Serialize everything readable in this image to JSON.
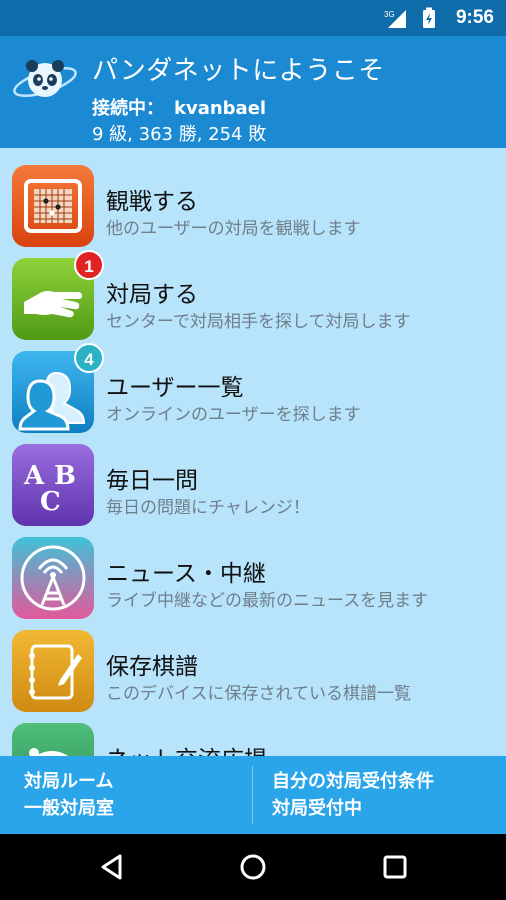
{
  "status_bar": {
    "network": "3G",
    "time": "9:56"
  },
  "header": {
    "title": "パンダネットにようこそ",
    "connection_label": "接続中：",
    "username": "kvanbael",
    "record": "9 級, 363 勝, 254 敗"
  },
  "menu": {
    "items": [
      {
        "title": "観戦する",
        "subtitle": "他のユーザーの対局を観戦します",
        "icon": "go-board-icon",
        "color": "#e8541c"
      },
      {
        "title": "対局する",
        "subtitle": "センターで対局相手を探して対局します",
        "icon": "hand-icon",
        "color": "#6fb624",
        "badge": "1",
        "badge_color": "#e02424"
      },
      {
        "title": "ユーザー一覧",
        "subtitle": "オンラインのユーザーを探します",
        "icon": "users-icon",
        "color": "#1f9ad6",
        "badge": "4",
        "badge_color": "#2ab3c6"
      },
      {
        "title": "毎日一問",
        "subtitle": "毎日の問題にチャレンジ！",
        "icon": "abc-icon",
        "color": "#7b4ec7"
      },
      {
        "title": "ニュース・中継",
        "subtitle": "ライブ中継などの最新のニュースを見ます",
        "icon": "broadcast-icon",
        "color": "#2aa5c8"
      },
      {
        "title": "保存棋譜",
        "subtitle": "このデバイスに保存されている棋譜一覧",
        "icon": "notebook-icon",
        "color": "#e2a21c"
      },
      {
        "title": "ネット交流広場",
        "subtitle": "",
        "icon": "community-icon",
        "color": "#3aa66a"
      }
    ]
  },
  "footer": {
    "room_label": "対局ルーム",
    "room_value": "一般対局室",
    "conditions_label": "自分の対局受付条件",
    "conditions_value": "対局受付中"
  }
}
